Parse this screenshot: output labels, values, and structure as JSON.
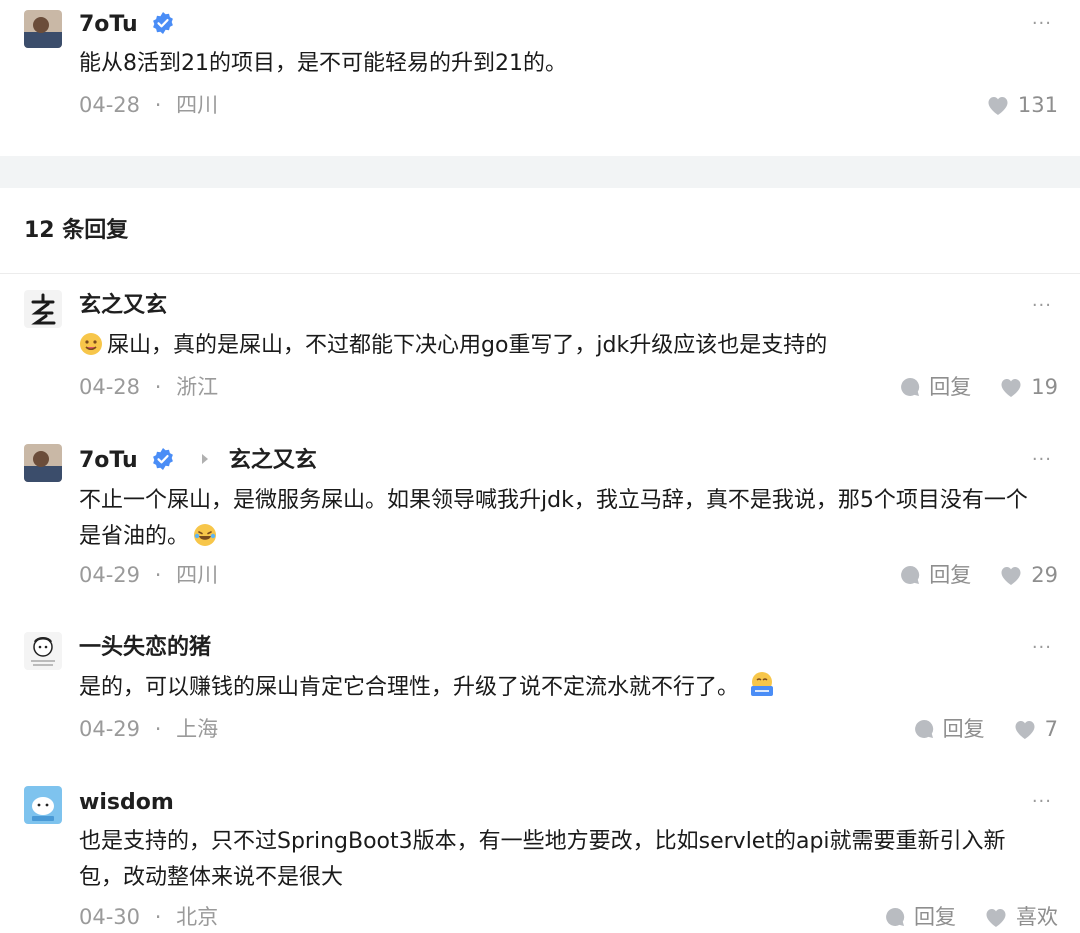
{
  "post": {
    "user": "7oTu",
    "text": "能从8活到21的项目，是不可能轻易的升到21的。",
    "date": "04-28",
    "location": "四川",
    "likes": "131"
  },
  "replies_header": "12 条回复",
  "replies": [
    {
      "user": "玄之又玄",
      "text": "屎山，真的是屎山，不过都能下决心用go重写了，jdk升级应该也是支持的",
      "date": "04-28",
      "location": "浙江",
      "reply_label": "回复",
      "likes": "19"
    },
    {
      "user": "7oTu",
      "reply_to": "玄之又玄",
      "text": "不止一个屎山，是微服务屎山。如果领导喊我升jdk，我立马辞，真不是我说，那5个项目没有一个是省油的。",
      "date": "04-29",
      "location": "四川",
      "reply_label": "回复",
      "likes": "29"
    },
    {
      "user": "一头失恋的猪",
      "text": "是的，可以赚钱的屎山肯定它合理性，升级了说不定流水就不行了。",
      "date": "04-29",
      "location": "上海",
      "reply_label": "回复",
      "likes": "7"
    },
    {
      "user": "wisdom",
      "text": "也是支持的，只不过SpringBoot3版本，有一些地方要改，比如servlet的api就需要重新引入新包，改动整体来说不是很大",
      "date": "04-30",
      "location": "北京",
      "reply_label": "回复",
      "likes": "喜欢"
    }
  ],
  "separator": "·",
  "more_glyph": "···",
  "colors": {
    "accent": "#4a8df6",
    "meta": "#9a9a9a",
    "icon": "#b9bcc1",
    "band": "#f2f4f5"
  },
  "icons": {
    "like": "heart-icon",
    "reply": "comment-bubble-icon",
    "verified": "verified-badge-icon",
    "more": "more-dots-icon",
    "reply_arrow": "triangle-right-icon"
  }
}
